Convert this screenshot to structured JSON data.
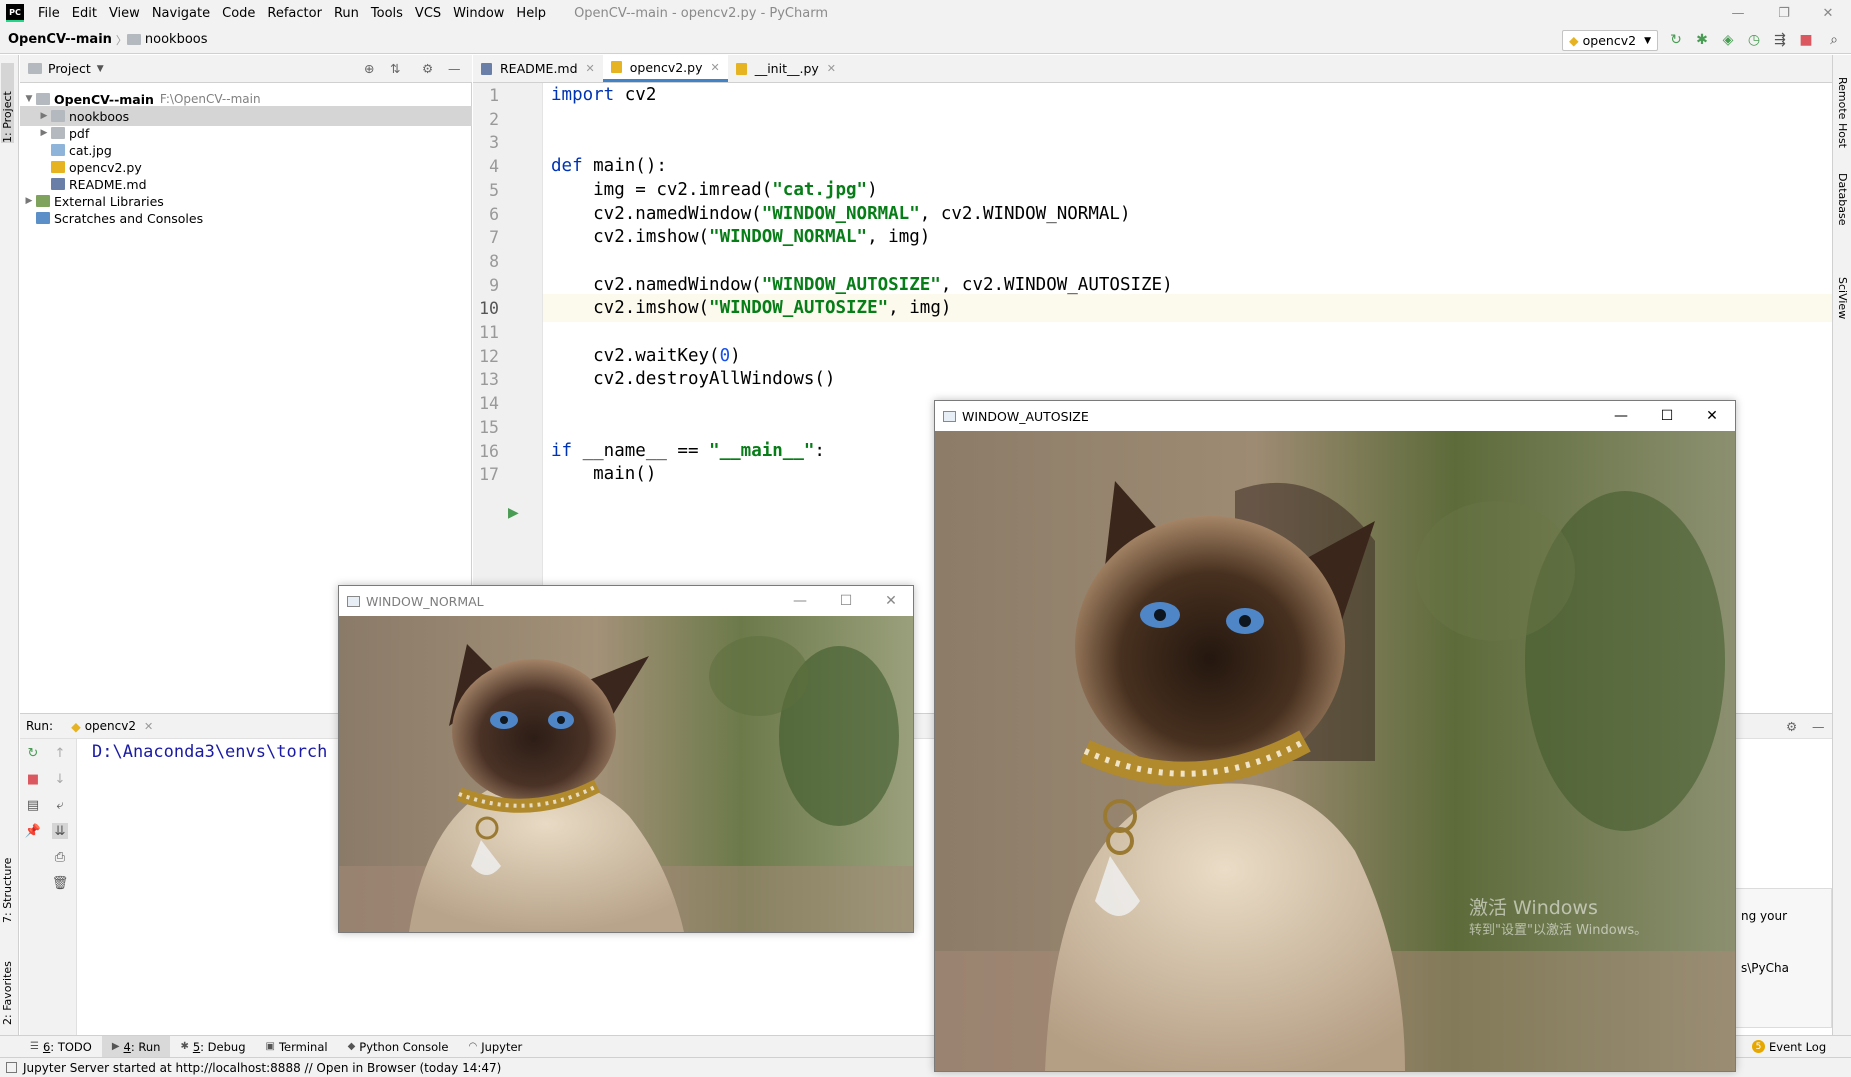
{
  "app": {
    "logo": "PC",
    "menu": [
      "File",
      "Edit",
      "View",
      "Navigate",
      "Code",
      "Refactor",
      "Run",
      "Tools",
      "VCS",
      "Window",
      "Help"
    ],
    "window_title": "OpenCV--main - opencv2.py - PyCharm",
    "window_controls": [
      "—",
      "❐",
      "✕"
    ]
  },
  "navbar": {
    "crumbs": [
      "OpenCV--main",
      "nookboos"
    ],
    "run_config": "opencv2"
  },
  "left_stripe": {
    "project": "1: Project",
    "structure": "7: Structure",
    "favorites": "2: Favorites"
  },
  "right_stripe": {
    "remote": "Remote Host",
    "database": "Database",
    "sciview": "SciView"
  },
  "project_panel": {
    "title": "Project",
    "tree": [
      {
        "label": "OpenCV--main",
        "path": "F:\\OpenCV--main",
        "bold": true,
        "depth": 0,
        "kind": "folder",
        "arrow": "▼"
      },
      {
        "label": "nookboos",
        "depth": 1,
        "kind": "folder",
        "arrow": "▶",
        "selected": true
      },
      {
        "label": "pdf",
        "depth": 1,
        "kind": "folder",
        "arrow": "▶"
      },
      {
        "label": "cat.jpg",
        "depth": 1,
        "kind": "image"
      },
      {
        "label": "opencv2.py",
        "depth": 1,
        "kind": "python"
      },
      {
        "label": "README.md",
        "depth": 1,
        "kind": "md"
      },
      {
        "label": "External Libraries",
        "depth": 0,
        "kind": "lib",
        "arrow": "▶"
      },
      {
        "label": "Scratches and Consoles",
        "depth": 0,
        "kind": "scratch"
      }
    ]
  },
  "editor": {
    "tabs": [
      {
        "label": "README.md",
        "active": false
      },
      {
        "label": "opencv2.py",
        "active": true
      },
      {
        "label": "__init__.py",
        "active": false
      }
    ],
    "current_line": 10,
    "lines": [
      [
        [
          "kw",
          "import"
        ],
        [
          "",
          " cv2"
        ]
      ],
      [],
      [],
      [
        [
          "kw",
          "def"
        ],
        [
          "",
          " main():"
        ]
      ],
      [
        [
          "",
          "    img = cv2.imread("
        ],
        [
          "st",
          "\"cat.jpg\""
        ],
        [
          "",
          ")"
        ]
      ],
      [
        [
          "",
          "    cv2.namedWindow("
        ],
        [
          "st",
          "\"WINDOW_NORMAL\""
        ],
        [
          "",
          ", cv2.WINDOW_NORMAL)"
        ]
      ],
      [
        [
          "",
          "    cv2.imshow("
        ],
        [
          "st",
          "\"WINDOW_NORMAL\""
        ],
        [
          "",
          ", img)"
        ]
      ],
      [],
      [
        [
          "",
          "    cv2.namedWindow("
        ],
        [
          "st",
          "\"WINDOW_AUTOSIZE\""
        ],
        [
          "",
          ", cv2.WINDOW_AUTOSIZE)"
        ]
      ],
      [
        [
          "",
          "    cv2.imshow("
        ],
        [
          "st",
          "\"WINDOW_AUTOSIZE\""
        ],
        [
          "",
          ", img)"
        ]
      ],
      [],
      [
        [
          "",
          "    cv2.waitKey("
        ],
        [
          "nm",
          "0"
        ],
        [
          "",
          ")"
        ]
      ],
      [
        [
          "",
          "    cv2.destroyAllWindows()"
        ]
      ],
      [],
      [],
      [
        [
          "kw",
          "if"
        ],
        [
          "",
          " __name__ == "
        ],
        [
          "st",
          "\"__main__\""
        ],
        [
          "",
          ":"
        ]
      ],
      [
        [
          "",
          "    main()"
        ]
      ]
    ]
  },
  "run_panel": {
    "label": "Run:",
    "tab": "opencv2",
    "output": "D:\\Anaconda3\\envs\\torch"
  },
  "notification": {
    "line1": "ng your",
    "line2": "s\\PyCha"
  },
  "tool_windows": [
    {
      "num": "6",
      "label": ": TODO",
      "icon": "☰"
    },
    {
      "num": "4",
      "label": ": Run",
      "icon": "▶",
      "active": true
    },
    {
      "num": "5",
      "label": ": Debug",
      "icon": "✱"
    },
    {
      "num": "",
      "label": "Terminal",
      "icon": "▣"
    },
    {
      "num": "",
      "label": "Python Console",
      "icon": "◆"
    },
    {
      "num": "",
      "label": "Jupyter",
      "icon": "◠"
    }
  ],
  "event_log": {
    "badge": "5",
    "label": "Event Log"
  },
  "status": {
    "message": "Jupyter Server started at http://localhost:8888 // Open in Browser (today 14:47)"
  },
  "cv_windows": {
    "normal": {
      "title": "WINDOW_NORMAL"
    },
    "autosize": {
      "title": "WINDOW_AUTOSIZE"
    }
  },
  "watermark": {
    "line1": "激活 Windows",
    "line2": "转到\"设置\"以激活 Windows。"
  },
  "colors": {
    "accent": "#4083c9",
    "keyword": "#0033b3",
    "string": "#067d17",
    "number": "#1750eb",
    "run_green": "#499c54",
    "stop_red": "#db5860"
  }
}
